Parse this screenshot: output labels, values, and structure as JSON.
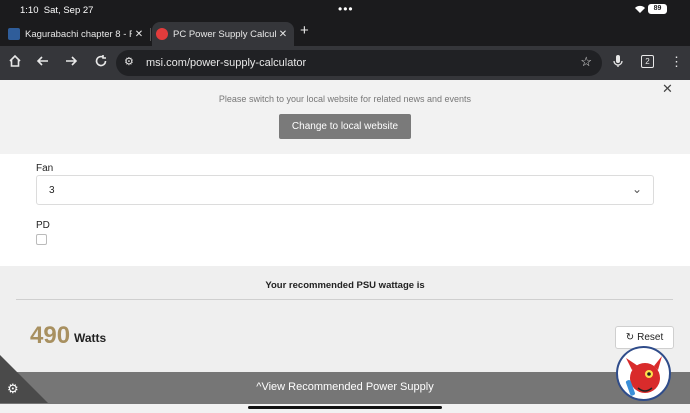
{
  "status_bar": {
    "time": "1:10",
    "date": "Sat, Sep 27",
    "battery": "89"
  },
  "tabs": [
    {
      "title": "Kagurabachi chapter 8 - Re"
    },
    {
      "title": "PC Power Supply Calculato"
    }
  ],
  "toolbar": {
    "url": "msi.com/power-supply-calculator",
    "tab_count": "2"
  },
  "banner": {
    "message": "Please switch to your local website for related news and events",
    "button_label": "Change to local website"
  },
  "form": {
    "fan_label": "Fan",
    "fan_value": "3",
    "pd_label": "PD"
  },
  "result": {
    "heading": "Your recommended PSU wattage is",
    "wattage": "490",
    "unit": "Watts",
    "reset_label": "Reset"
  },
  "bottom_bar": {
    "label": "View Recommended Power Supply"
  },
  "colors": {
    "wattage": "#a89060",
    "bottom_bar": "#767676",
    "banner_button": "#7a7a7a"
  }
}
